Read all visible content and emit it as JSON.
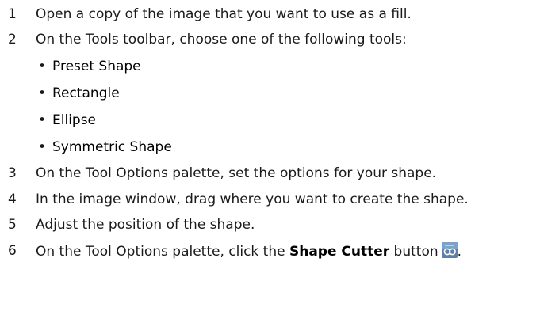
{
  "steps": [
    {
      "num": "1",
      "text": "Open a copy of the image that you want to use as a fill."
    },
    {
      "num": "2",
      "text": "On the Tools toolbar, choose one of the following tools:"
    },
    {
      "num": "3",
      "text": "On the Tool Options palette, set the options for your shape."
    },
    {
      "num": "4",
      "text": "In the image window, drag where you want to create the shape."
    },
    {
      "num": "5",
      "text": "Adjust the position of the shape."
    },
    {
      "num": "6",
      "text_before": "On the Tool Options palette, click the ",
      "bold": "Shape Cutter",
      "text_after": " button",
      "end": "."
    }
  ],
  "tools": [
    "Preset Shape",
    "Rectangle",
    "Ellipse",
    "Symmetric Shape"
  ],
  "icons": {
    "step6": "shape-cutter-icon"
  }
}
